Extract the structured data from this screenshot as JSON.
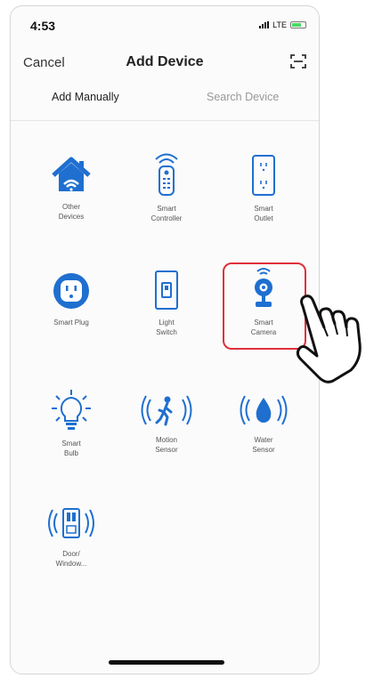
{
  "status_bar": {
    "time": "4:53",
    "network": "LTE"
  },
  "header": {
    "cancel_label": "Cancel",
    "title": "Add Device"
  },
  "tabs": [
    {
      "label": "Add Manually",
      "active": true
    },
    {
      "label": "Search Device",
      "active": false
    }
  ],
  "devices": [
    {
      "label": "Other\nDevices",
      "icon": "home-icon"
    },
    {
      "label": "Smart\nController",
      "icon": "remote-icon"
    },
    {
      "label": "Smart\nOutlet",
      "icon": "outlet-icon"
    },
    {
      "label": "Smart Plug",
      "icon": "plug-icon"
    },
    {
      "label": "Light\nSwitch",
      "icon": "light-switch-icon"
    },
    {
      "label": "Smart\nCamera",
      "icon": "camera-icon",
      "highlighted": true
    },
    {
      "label": "Smart\nBulb",
      "icon": "bulb-icon"
    },
    {
      "label": "Motion\nSensor",
      "icon": "motion-sensor-icon"
    },
    {
      "label": "Water\nSensor",
      "icon": "water-sensor-icon"
    },
    {
      "label": "Door/\nWindow...",
      "icon": "door-window-sensor-icon"
    }
  ],
  "colors": {
    "accent": "#1f6fd0",
    "highlight": "#e0303a"
  }
}
